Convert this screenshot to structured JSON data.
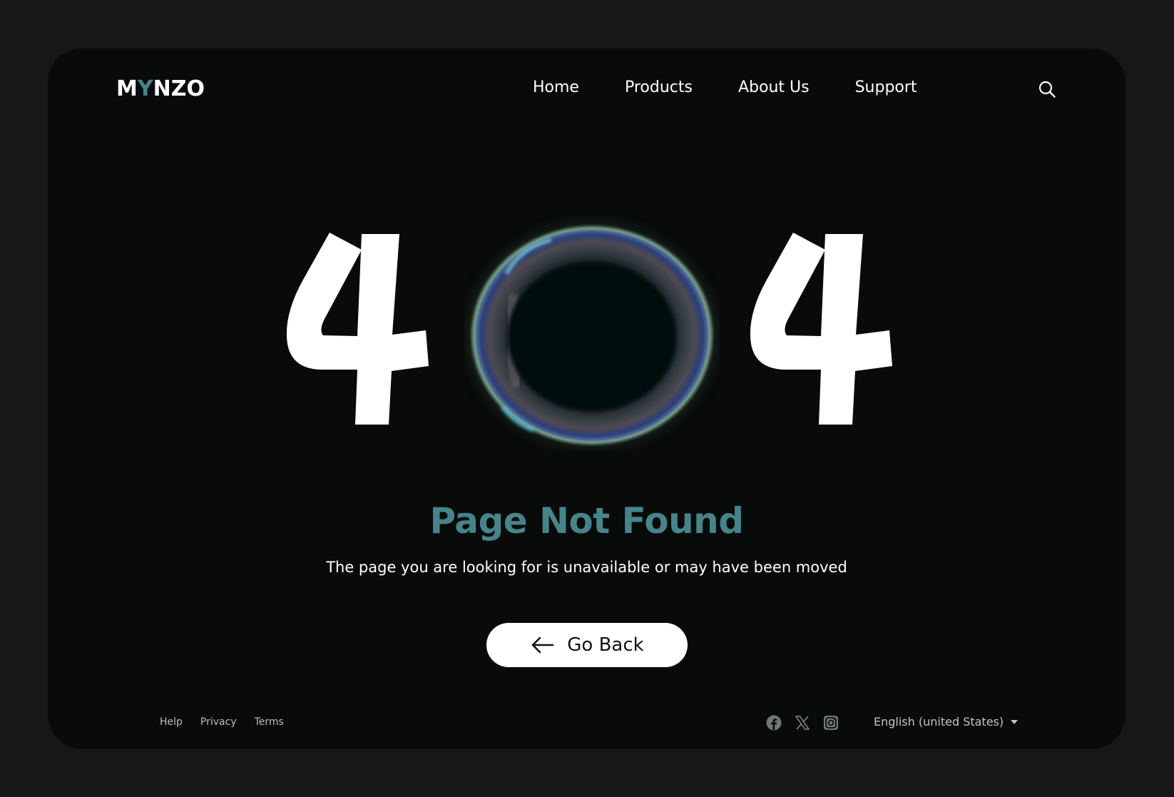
{
  "brand": {
    "logo_part1": "M",
    "logo_accent": "Y",
    "logo_part2": "NZO",
    "accent_color": "#46848a"
  },
  "nav": {
    "items": [
      {
        "label": "Home"
      },
      {
        "label": "Products"
      },
      {
        "label": "About Us"
      },
      {
        "label": "Support"
      }
    ],
    "search_icon": "search-icon"
  },
  "hero": {
    "code_digits": [
      "4",
      "0",
      "4"
    ],
    "zero_style": "iridescent-bubble"
  },
  "message": {
    "title": "Page Not Found",
    "subtitle": "The page you are looking for is unavailable or may have been moved"
  },
  "actions": {
    "go_back_label": "Go Back",
    "go_back_icon": "arrow-left-icon"
  },
  "footer": {
    "links": [
      {
        "label": "Help"
      },
      {
        "label": "Privacy"
      },
      {
        "label": "Terms"
      }
    ],
    "socials": [
      {
        "name": "facebook-icon"
      },
      {
        "name": "x-icon"
      },
      {
        "name": "instagram-icon"
      }
    ],
    "language": "English (united States)"
  }
}
